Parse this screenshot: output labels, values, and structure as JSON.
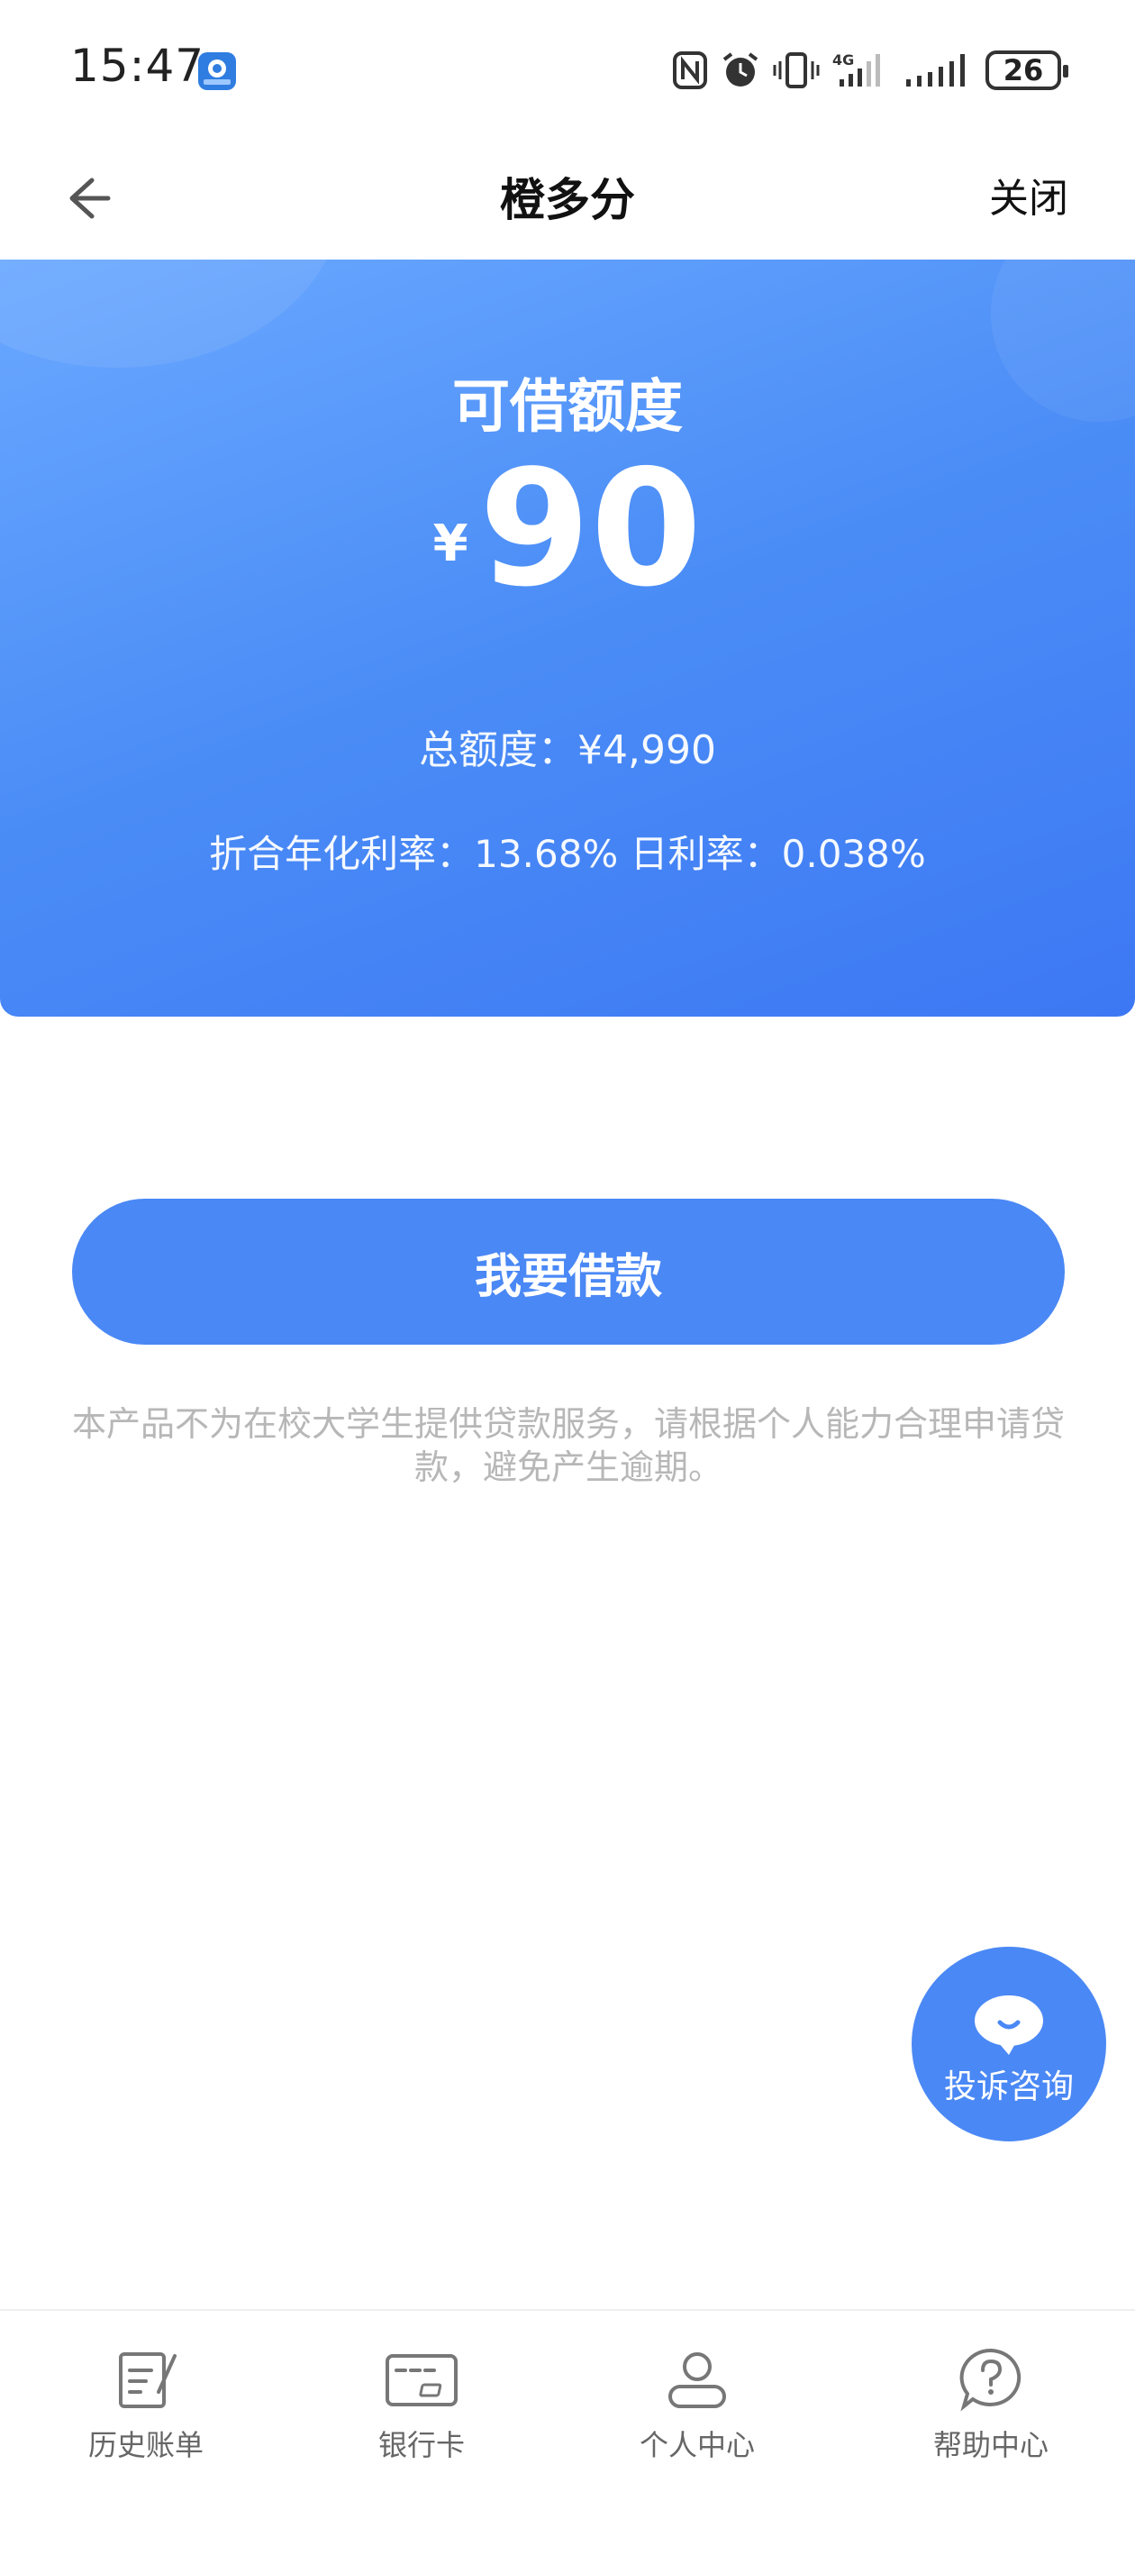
{
  "status_bar": {
    "time": "15:47",
    "battery": "26",
    "network": "4G",
    "icons": [
      "nfc-icon",
      "alarm-icon",
      "vibrate-icon",
      "signal-icon",
      "battery-icon"
    ]
  },
  "nav": {
    "title": "橙多分",
    "close_label": "关闭"
  },
  "hero": {
    "label": "可借额度",
    "currency": "¥",
    "amount": "90",
    "total_quota": "总额度：¥4,990",
    "rate_text": "折合年化利率：13.68%  日利率：0.038%"
  },
  "actions": {
    "borrow_label": "我要借款",
    "disclaimer": "本产品不为在校大学生提供贷款服务，请根据个人能力合理申请贷款，避免产生逾期。"
  },
  "floating": {
    "complaint_label": "投诉咨询"
  },
  "tabs": [
    {
      "label": "历史账单",
      "icon": "bill-icon"
    },
    {
      "label": "银行卡",
      "icon": "bank-card-icon"
    },
    {
      "label": "个人中心",
      "icon": "user-icon"
    },
    {
      "label": "帮助中心",
      "icon": "help-icon"
    }
  ],
  "colors": {
    "accent": "#4a88f5",
    "hero_start": "#6aa8ff",
    "hero_end": "#3d78f4",
    "disclaimer": "#b7b7b7"
  }
}
